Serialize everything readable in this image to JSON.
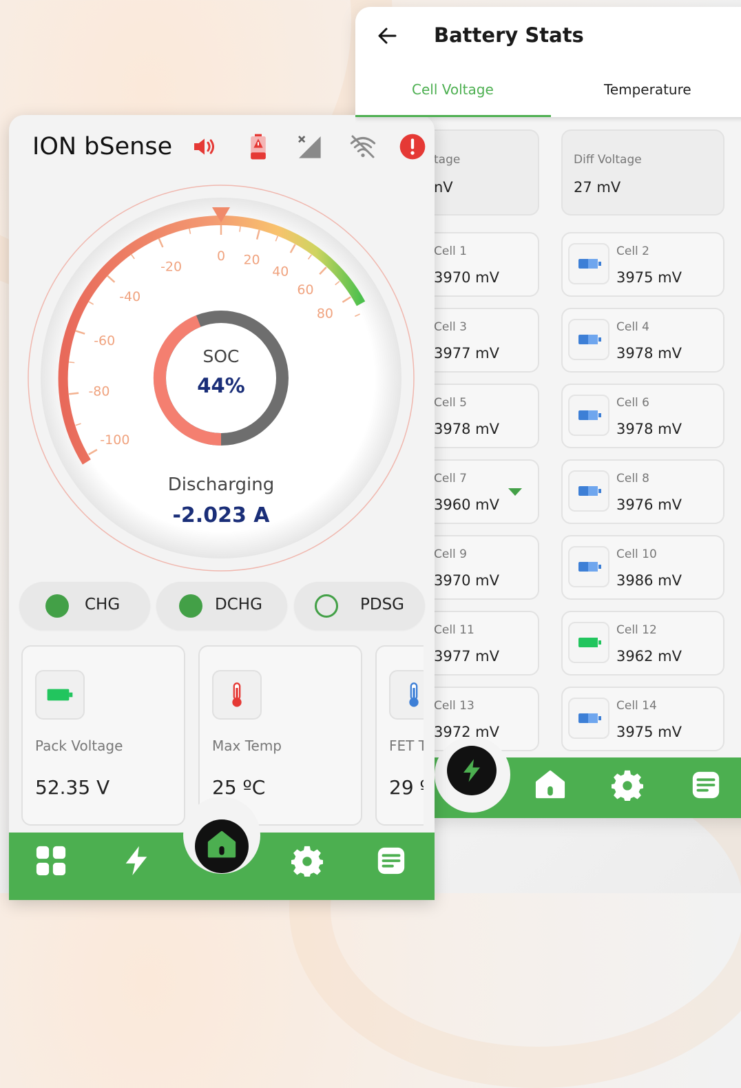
{
  "battery_stats": {
    "title": "Battery Stats",
    "tabs": [
      "Cell Voltage",
      "Temperature"
    ],
    "summary": [
      {
        "label": "tage",
        "value": "nV"
      },
      {
        "label": "Diff Voltage",
        "value": "27 mV"
      }
    ],
    "cells": [
      {
        "label": "Cell 1",
        "value": "3970 mV"
      },
      {
        "label": "Cell 2",
        "value": "3975 mV"
      },
      {
        "label": "Cell 3",
        "value": "3977 mV"
      },
      {
        "label": "Cell 4",
        "value": "3978 mV"
      },
      {
        "label": "Cell 5",
        "value": "3978 mV"
      },
      {
        "label": "Cell 6",
        "value": "3978 mV"
      },
      {
        "label": "Cell 7",
        "value": "3960 mV"
      },
      {
        "label": "Cell 8",
        "value": "3976 mV"
      },
      {
        "label": "Cell 9",
        "value": "3970 mV"
      },
      {
        "label": "Cell 10",
        "value": "3986 mV"
      },
      {
        "label": "Cell 11",
        "value": "3977 mV"
      },
      {
        "label": "Cell 12",
        "value": "3962 mV"
      },
      {
        "label": "Cell 13",
        "value": "3972 mV"
      },
      {
        "label": "Cell 14",
        "value": "3975 mV"
      }
    ]
  },
  "dashboard": {
    "app_name": "ION bSense",
    "gauge": {
      "ticks": [
        "-100",
        "-80",
        "-60",
        "-40",
        "-20",
        "0",
        "20",
        "40",
        "60",
        "80"
      ],
      "min": -100,
      "max": 100,
      "soc_label": "SOC",
      "soc_value": "44%",
      "soc_fraction": 0.44,
      "state": "Discharging",
      "current": "-2.023 A"
    },
    "chips": [
      "CHG",
      "DCHG",
      "PDSG"
    ],
    "stats": [
      {
        "label": "Pack Voltage",
        "value": "52.35 V"
      },
      {
        "label": "Max Temp",
        "value": "25 ºC"
      },
      {
        "label": "FET T",
        "value": "29 º"
      }
    ]
  },
  "colors": {
    "accent": "#4caf50",
    "value_blue": "#1a2e78",
    "alert": "#e53935"
  }
}
